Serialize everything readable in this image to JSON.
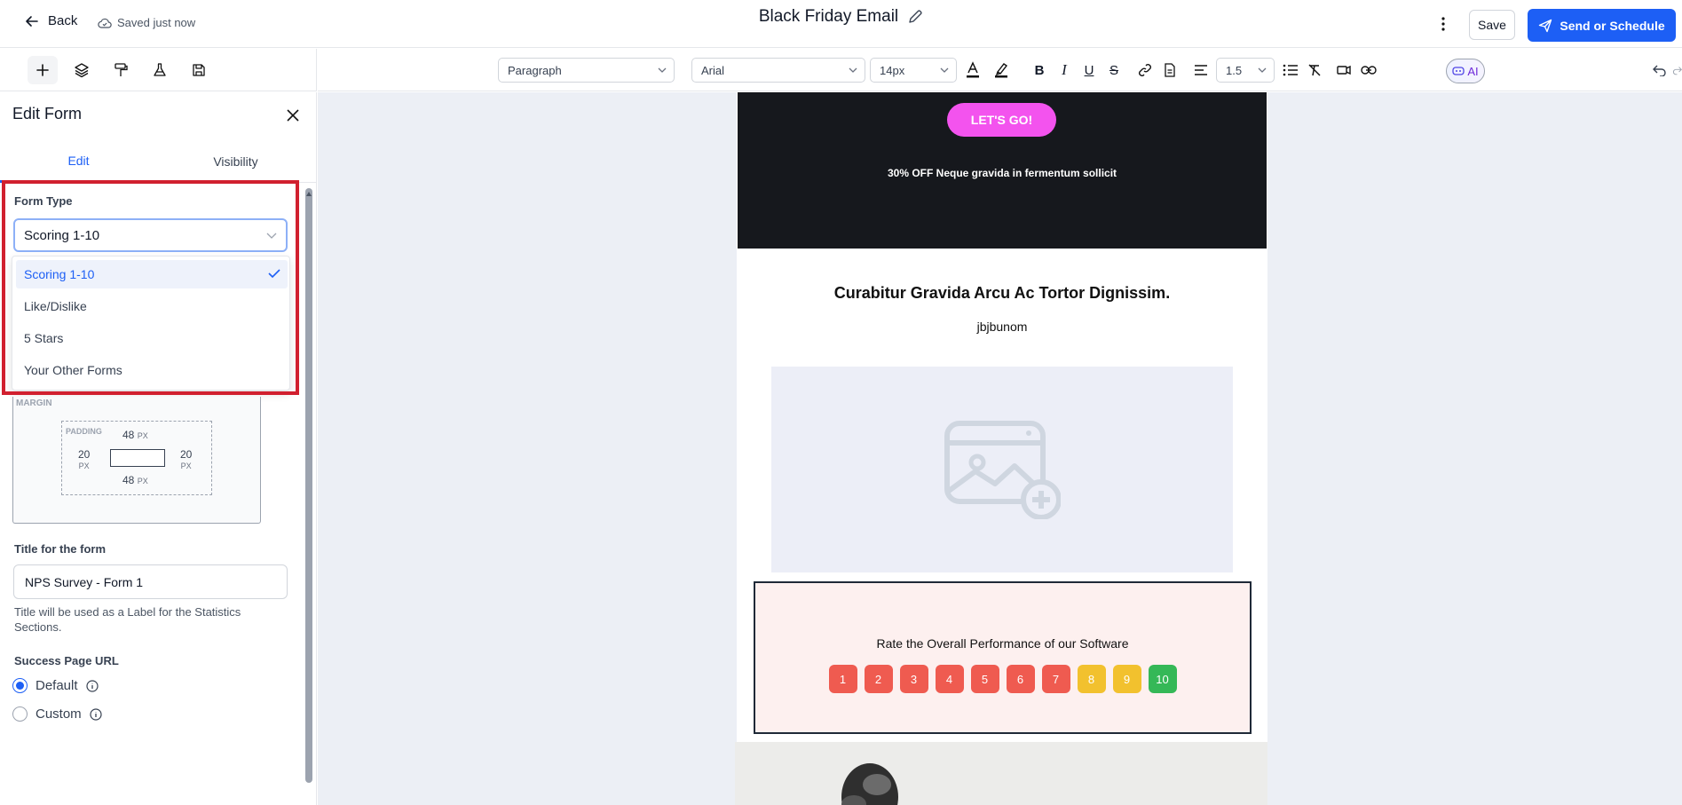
{
  "header": {
    "back_label": "Back",
    "saved_status": "Saved just now",
    "title": "Black Friday Email",
    "save_label": "Save",
    "send_label": "Send or Schedule"
  },
  "toolbar": {
    "block_type": "Paragraph",
    "font_family": "Arial",
    "font_size": "14px",
    "line_height": "1.5",
    "ai_label": "AI"
  },
  "panel": {
    "title": "Edit Form",
    "tabs": [
      {
        "label": "Edit",
        "active": true
      },
      {
        "label": "Visibility",
        "active": false
      }
    ],
    "form_type_label": "Form Type",
    "form_type_value": "Scoring 1-10",
    "form_type_options": [
      {
        "label": "Scoring 1-10",
        "selected": true
      },
      {
        "label": "Like/Dislike",
        "selected": false
      },
      {
        "label": "5 Stars",
        "selected": false
      },
      {
        "label": "Your Other Forms",
        "selected": false
      }
    ],
    "box_model": {
      "margin_label": "MARGIN",
      "padding_label": "PADDING",
      "padding_top": "48",
      "padding_bottom": "48",
      "padding_left": "20",
      "padding_right": "20",
      "unit": "PX"
    },
    "title_label": "Title for the form",
    "title_value": "NPS Survey - Form 1",
    "title_help": "Title will be used as a Label for the Statistics Sections.",
    "success_label": "Success Page URL",
    "success_options": [
      {
        "label": "Default",
        "checked": true
      },
      {
        "label": "Custom",
        "checked": false
      }
    ]
  },
  "email": {
    "cta_label": "LET'S GO!",
    "hero_text": "30% OFF Neque gravida in fermentum sollicit",
    "heading": "Curabitur Gravida Arcu Ac Tortor Dignissim.",
    "subtext": "jbjbunom",
    "nps_title": "Rate the Overall Performance of our Software",
    "scores": [
      {
        "label": "1",
        "color": "#ef5b50"
      },
      {
        "label": "2",
        "color": "#ef5b50"
      },
      {
        "label": "3",
        "color": "#ef5b50"
      },
      {
        "label": "4",
        "color": "#ef5b50"
      },
      {
        "label": "5",
        "color": "#ef5b50"
      },
      {
        "label": "6",
        "color": "#ef5b50"
      },
      {
        "label": "7",
        "color": "#ef5b50"
      },
      {
        "label": "8",
        "color": "#f2c12e"
      },
      {
        "label": "9",
        "color": "#f2c12e"
      },
      {
        "label": "10",
        "color": "#35b857"
      }
    ]
  },
  "colors": {
    "primary": "#1d5ff5",
    "highlight_border": "#d1202f",
    "cta_pink": "#f353ee",
    "hero_bg": "#16181d"
  }
}
